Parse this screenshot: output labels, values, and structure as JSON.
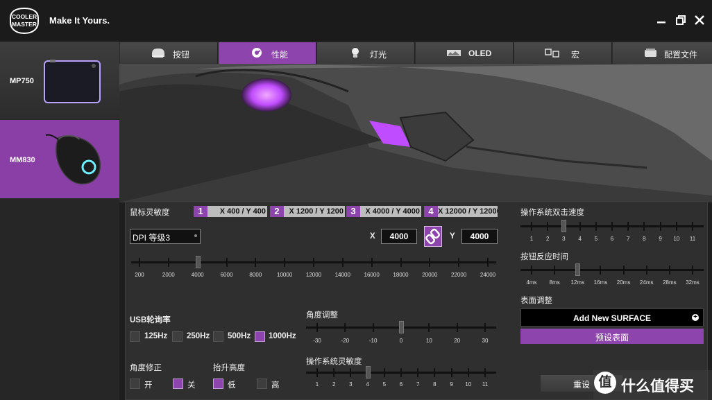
{
  "header": {
    "brand": "COOLER MASTER",
    "slogan": "Make It Yours."
  },
  "sidebar": {
    "devices": [
      {
        "label": "MP750"
      },
      {
        "label": "MM830"
      }
    ]
  },
  "tabs": [
    {
      "label": "按钮",
      "icon": "mouse-button-icon"
    },
    {
      "label": "性能",
      "icon": "performance-gauge-icon"
    },
    {
      "label": "灯光",
      "icon": "light-bulb-icon"
    },
    {
      "label": "OLED",
      "icon": "oled-display-icon"
    },
    {
      "label": "宏",
      "icon": "macro-icon"
    },
    {
      "label": "配置文件",
      "icon": "profile-icon"
    }
  ],
  "dpi": {
    "title": "鼠标灵敏度",
    "levels": [
      {
        "num": "1",
        "value": "X 400 / Y 400"
      },
      {
        "num": "2",
        "value": "X 1200 / Y 1200"
      },
      {
        "num": "3",
        "value": "X 4000 / Y 4000"
      },
      {
        "num": "4",
        "value": "X 12000 / Y 12000"
      }
    ],
    "stage_select": "DPI 等级3",
    "x_label": "X",
    "x_value": "4000",
    "y_label": "Y",
    "y_value": "4000",
    "ticks": [
      "200",
      "2000",
      "4000",
      "6000",
      "8000",
      "10000",
      "12000",
      "14000",
      "16000",
      "18000",
      "20000",
      "22000",
      "24000"
    ],
    "selected_index": 2
  },
  "usb": {
    "title": "USB轮询率",
    "options": [
      {
        "label": "125Hz",
        "checked": false
      },
      {
        "label": "250Hz",
        "checked": false
      },
      {
        "label": "500Hz",
        "checked": false
      },
      {
        "label": "1000Hz",
        "checked": true
      }
    ]
  },
  "angle_correction": {
    "title": "角度修正",
    "options": [
      {
        "label": "开",
        "checked": false
      },
      {
        "label": "关",
        "checked": true
      }
    ]
  },
  "lift_height": {
    "title": "抬升高度",
    "options": [
      {
        "label": "低",
        "checked": true
      },
      {
        "label": "高",
        "checked": false
      }
    ]
  },
  "angle_adjust": {
    "title": "角度调整",
    "ticks": [
      "-30",
      "-20",
      "-10",
      "0",
      "10",
      "20",
      "30"
    ],
    "selected_index": 3
  },
  "os_sensitivity": {
    "title": "操作系统灵敏度",
    "ticks": [
      "1",
      "2",
      "3",
      "4",
      "5",
      "6",
      "7",
      "8",
      "9",
      "10",
      "11"
    ],
    "selected_index": 3
  },
  "double_click": {
    "title": "操作系统双击速度",
    "ticks": [
      "1",
      "2",
      "3",
      "4",
      "5",
      "6",
      "7",
      "8",
      "9",
      "10",
      "11"
    ],
    "selected_index": 2
  },
  "button_response": {
    "title": "按钮反应时间",
    "ticks": [
      "4ms",
      "8ms",
      "12ms",
      "16ms",
      "20ms",
      "24ms",
      "28ms",
      "32ms"
    ],
    "selected_index": 2
  },
  "surface": {
    "title": "表面调整",
    "add_label": "Add New SURFACE",
    "preset_label": "预设表面"
  },
  "reset_label": "重设",
  "watermark": {
    "text": "什么值得买",
    "glyph": "值"
  },
  "colors": {
    "accent": "#8e44ad",
    "panel": "#2f2f2f",
    "titlebar": "#1b1b1b"
  }
}
